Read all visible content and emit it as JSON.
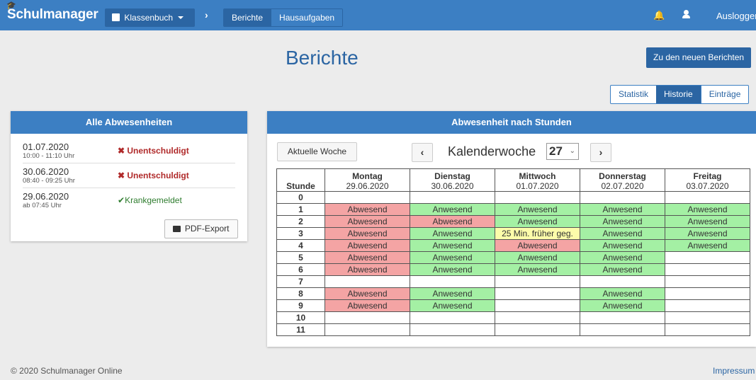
{
  "navbar": {
    "brand": "Schulmanager",
    "klassenbuch_label": "Klassenbuch",
    "tabs": [
      "Berichte",
      "Hausaufgaben"
    ],
    "logout_label": "Ausloggen"
  },
  "page": {
    "title": "Berichte",
    "new_reports_button": "Zu den neuen Berichten",
    "view_tabs": [
      "Statistik",
      "Historie",
      "Einträge"
    ],
    "active_view": "Historie"
  },
  "absences_panel": {
    "title": "Alle Abwesenheiten",
    "items": [
      {
        "date": "01.07.2020",
        "time": "10:00 - 11:10 Uhr",
        "status": "Unentschuldigt"
      },
      {
        "date": "30.06.2020",
        "time": "08:40 - 09:25 Uhr",
        "status": "Unentschuldigt"
      },
      {
        "date": "29.06.2020",
        "time": "ab 07:45 Uhr",
        "status": "Krankgemeldet"
      }
    ],
    "pdf_button": "PDF-Export"
  },
  "hours_panel": {
    "title": "Abwesenheit nach Stunden",
    "current_week_button": "Aktuelle Woche",
    "week_label": "Kalenderwoche",
    "week_number": "27",
    "stunde_header": "Stunde",
    "days": [
      {
        "name": "Montag",
        "date": "29.06.2020"
      },
      {
        "name": "Dienstag",
        "date": "30.06.2020"
      },
      {
        "name": "Mittwoch",
        "date": "01.07.2020"
      },
      {
        "name": "Donnerstag",
        "date": "02.07.2020"
      },
      {
        "name": "Freitag",
        "date": "03.07.2020"
      }
    ],
    "rows": [
      {
        "stunde": "0",
        "cells": [
          "",
          "",
          "",
          "",
          ""
        ]
      },
      {
        "stunde": "1",
        "cells": [
          "Abwesend",
          "Anwesend",
          "Anwesend",
          "Anwesend",
          "Anwesend"
        ]
      },
      {
        "stunde": "2",
        "cells": [
          "Abwesend",
          "Abwesend",
          "Anwesend",
          "Anwesend",
          "Anwesend"
        ]
      },
      {
        "stunde": "3",
        "cells": [
          "Abwesend",
          "Anwesend",
          "25 Min. früher geg.",
          "Anwesend",
          "Anwesend"
        ]
      },
      {
        "stunde": "4",
        "cells": [
          "Abwesend",
          "Anwesend",
          "Abwesend",
          "Anwesend",
          "Anwesend"
        ]
      },
      {
        "stunde": "5",
        "cells": [
          "Abwesend",
          "Anwesend",
          "Anwesend",
          "Anwesend",
          ""
        ]
      },
      {
        "stunde": "6",
        "cells": [
          "Abwesend",
          "Anwesend",
          "Anwesend",
          "Anwesend",
          ""
        ]
      },
      {
        "stunde": "7",
        "cells": [
          "",
          "",
          "",
          "",
          ""
        ]
      },
      {
        "stunde": "8",
        "cells": [
          "Abwesend",
          "Anwesend",
          "",
          "Anwesend",
          ""
        ]
      },
      {
        "stunde": "9",
        "cells": [
          "Abwesend",
          "Anwesend",
          "",
          "Anwesend",
          ""
        ]
      },
      {
        "stunde": "10",
        "cells": [
          "",
          "",
          "",
          "",
          ""
        ]
      },
      {
        "stunde": "11",
        "cells": [
          "",
          "",
          "",
          "",
          ""
        ]
      }
    ]
  },
  "footer": {
    "copyright": "© 2020 Schulmanager Online",
    "impressum": "Impressum"
  },
  "colors": {
    "brand_blue": "#3c7fc3",
    "dark_blue": "#2b65a3",
    "absent": "#f4a4a4",
    "present": "#a4f0a4",
    "early": "#fcfcaa",
    "unexcused": "#b02a2a",
    "sick": "#2f7d2f"
  }
}
